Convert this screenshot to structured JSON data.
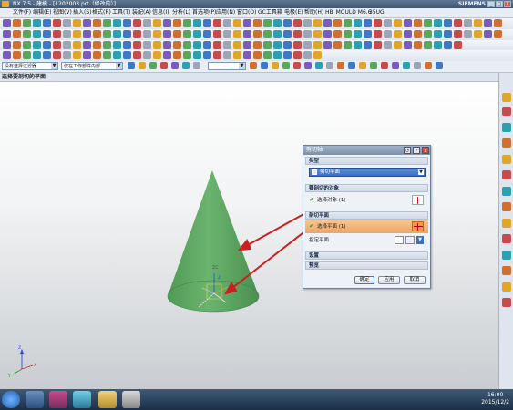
{
  "window": {
    "title": "NX 7.5 - 建模 - [1202003.prt（修改的）]",
    "brand": "SIEMENS",
    "minimize": "_",
    "maximize": "□",
    "close": "X"
  },
  "menu": [
    "文件(F)",
    "编辑(E)",
    "视图(V)",
    "插入(S)",
    "格式(R)",
    "工具(T)",
    "装配(A)",
    "信息(I)",
    "分析(L)",
    "首选项(P)",
    "应用(N)",
    "窗口(O)",
    "GC工具箱",
    "电极(E)",
    "帮助(H)",
    "HB_MOULD M6.6",
    "35UG"
  ],
  "selection_bar": {
    "filter": "没有选择过滤器",
    "scope": "仅在工作部件内部"
  },
  "cue_line": "选择要剖切的平面",
  "dialog": {
    "title": "剪切轴",
    "sections": {
      "type": "类型",
      "target": "要剖切的对象",
      "plane": "剖切平面",
      "settings": "设置",
      "preview": "预览"
    },
    "type_value": "剪切平面",
    "select_object": "选择对象 (1)",
    "select_plane": "选择平面 (1)",
    "specify_plane": "指定平面",
    "ok": "确定",
    "apply": "应用",
    "cancel": "取消"
  },
  "axis_labels": {
    "z": "Z",
    "x": "X",
    "y": "Y",
    "zc": "ZC"
  },
  "clock": {
    "time": "16:00",
    "date": "2015/12/2"
  },
  "colors": {
    "cone": "#5fa863",
    "arrow": "#cc1f1f",
    "dialog_highlight": "#f0a35a"
  }
}
